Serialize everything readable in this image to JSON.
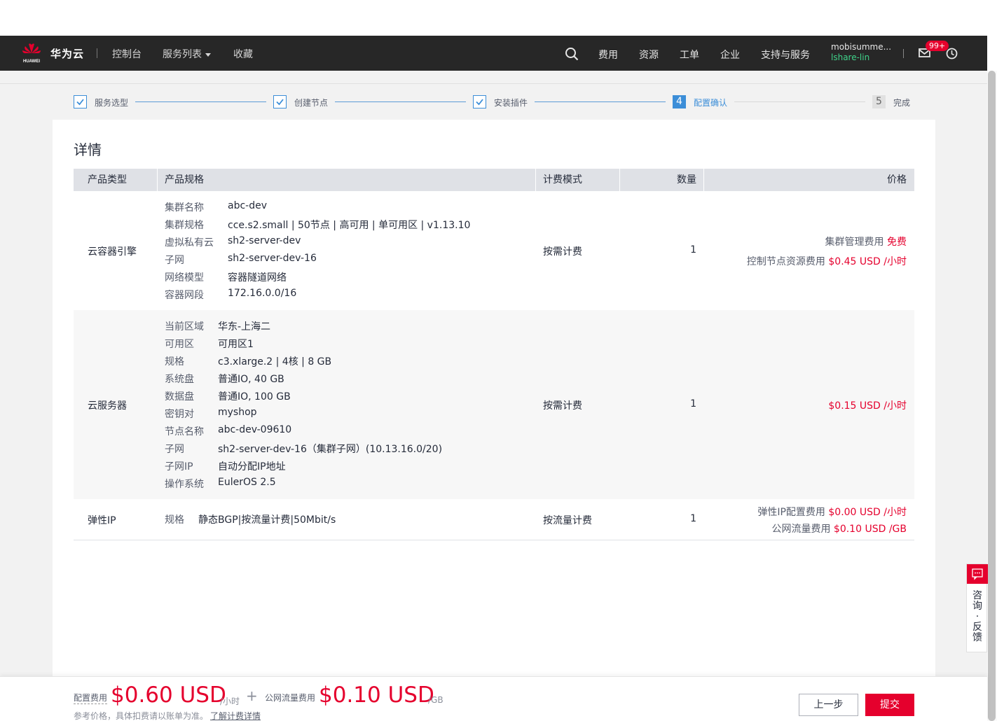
{
  "header": {
    "logo_text": "华为云",
    "logo_sub": "HUAWEI",
    "nav_left": [
      "控制台",
      "服务列表",
      "收藏"
    ],
    "nav_right": [
      "费用",
      "资源",
      "工单",
      "企业",
      "支持与服务"
    ],
    "user_name": "mobisumme...",
    "user_sub": "lshare-lin",
    "badge": "99+"
  },
  "steps": [
    {
      "label": "服务选型",
      "state": "done"
    },
    {
      "label": "创建节点",
      "state": "done"
    },
    {
      "label": "安装插件",
      "state": "done"
    },
    {
      "num": "4",
      "label": "配置确认",
      "state": "active"
    },
    {
      "num": "5",
      "label": "完成",
      "state": "todo"
    }
  ],
  "detail": {
    "title": "详情",
    "columns": [
      "产品类型",
      "产品规格",
      "计费模式",
      "数量",
      "价格"
    ],
    "rows": [
      {
        "type": "云容器引擎",
        "specs": [
          {
            "k": "集群名称",
            "v": "abc-dev"
          },
          {
            "k": "集群规格",
            "v": "cce.s2.small | 50节点 | 高可用 | 单可用区 | v1.13.10"
          },
          {
            "k": "虚拟私有云",
            "v": "sh2-server-dev"
          },
          {
            "k": "子网",
            "v": "sh2-server-dev-16"
          },
          {
            "k": "网络模型",
            "v": "容器隧道网络"
          },
          {
            "k": "容器网段",
            "v": "172.16.0.0/16"
          }
        ],
        "billing": "按需计费",
        "qty": "1",
        "prices": [
          {
            "label": "集群管理费用 ",
            "value": "免费"
          },
          {
            "label": "控制节点资源费用 ",
            "value": "$0.45 USD /小时"
          }
        ]
      },
      {
        "type": "云服务器",
        "specs": [
          {
            "k": "当前区域",
            "v": "华东-上海二"
          },
          {
            "k": "可用区",
            "v": "可用区1"
          },
          {
            "k": "规格",
            "v": "c3.xlarge.2 | 4核 | 8 GB"
          },
          {
            "k": "系统盘",
            "v": "普通IO, 40 GB"
          },
          {
            "k": "数据盘",
            "v": "普通IO, 100 GB"
          },
          {
            "k": "密钥对",
            "v": "myshop"
          },
          {
            "k": "节点名称",
            "v": "abc-dev-09610"
          },
          {
            "k": "子网",
            "v": "sh2-server-dev-16（集群子网）(10.13.16.0/20)"
          },
          {
            "k": "子网IP",
            "v": "自动分配IP地址"
          },
          {
            "k": "操作系统",
            "v": "EulerOS 2.5"
          }
        ],
        "billing": "按需计费",
        "qty": "1",
        "prices": [
          {
            "label": "",
            "value": "$0.15 USD /小时"
          }
        ]
      },
      {
        "type": "弹性IP",
        "specs": [
          {
            "k": "规格",
            "v": "静态BGP|按流量计费|50Mbit/s"
          }
        ],
        "billing": "按流量计费",
        "qty": "1",
        "prices": [
          {
            "label": "弹性IP配置费用 ",
            "value": "$0.00 USD /小时"
          },
          {
            "label": "公网流量费用 ",
            "value": "$0.10 USD /GB"
          }
        ]
      }
    ]
  },
  "consult": "咨询·反馈",
  "footer": {
    "config_label": "配置费用",
    "config_price": "$0.60 USD",
    "config_unit": "/小时",
    "plus": "+",
    "traffic_label": "公网流量费用",
    "traffic_price": "$0.10 USD",
    "traffic_unit": "/GB",
    "note": "参考价格，具体扣费请以账单为准。",
    "link": "了解计费详情",
    "prev_button": "上一步",
    "submit_button": "提交"
  },
  "colors": {
    "accent_red": "#e5002d",
    "step_blue": "#3c8ed8",
    "header_bg": "#272727",
    "user_green": "#3fd38a"
  }
}
